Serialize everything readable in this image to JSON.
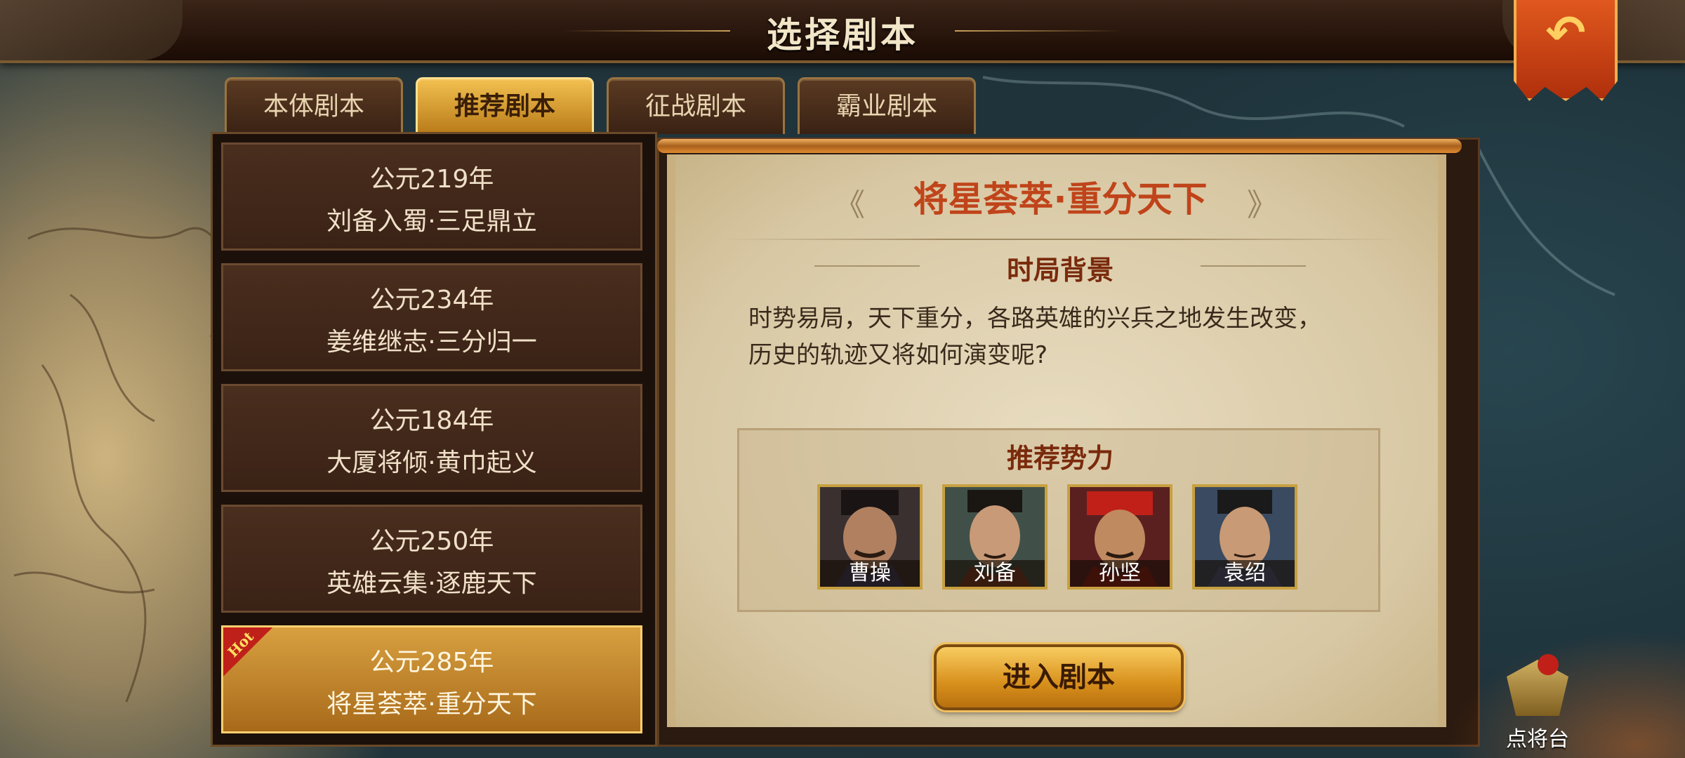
{
  "header": {
    "title": "选择剧本",
    "back_icon": "back-arrow-icon"
  },
  "tabs": [
    {
      "label": "本体剧本",
      "active": false
    },
    {
      "label": "推荐剧本",
      "active": true
    },
    {
      "label": "征战剧本",
      "active": false
    },
    {
      "label": "霸业剧本",
      "active": false
    }
  ],
  "scenarios": [
    {
      "year": "公元219年",
      "name": "刘备入蜀·三足鼎立"
    },
    {
      "year": "公元234年",
      "name": "姜维继志·三分归一"
    },
    {
      "year": "公元184年",
      "name": "大厦将倾·黄巾起义"
    },
    {
      "year": "公元250年",
      "name": "英雄云集·逐鹿天下"
    },
    {
      "year": "公元285年",
      "name": "将星荟萃·重分天下",
      "badge": "Hot",
      "selected": true
    }
  ],
  "detail": {
    "title": "将星荟萃·重分天下",
    "background_heading": "时局背景",
    "description_line1": "时势易局，天下重分，各路英雄的兴兵之地发生改变，",
    "description_line2": "历史的轨迹又将如何演变呢?",
    "recommend_heading": "推荐势力",
    "heroes": [
      {
        "name": "曹操"
      },
      {
        "name": "刘备"
      },
      {
        "name": "孙坚"
      },
      {
        "name": "袁绍"
      }
    ],
    "enter_button": "进入剧本"
  },
  "general_button": {
    "label": "点将台"
  },
  "colors": {
    "accent_gold": "#d8a040",
    "title_red": "#c0441a",
    "heading_brown": "#7a2a0c"
  }
}
